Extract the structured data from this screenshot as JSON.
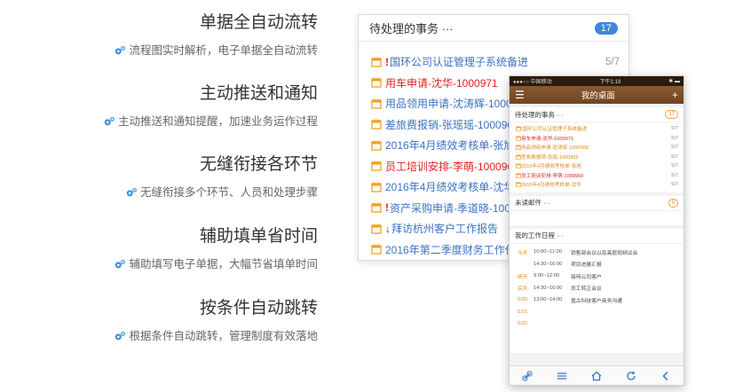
{
  "features": [
    {
      "title": "单据全自动流转",
      "desc": "流程图实时解析，电子单据全自动流转"
    },
    {
      "title": "主动推送和通知",
      "desc": "主动推送和通知提醒，加速业务运作过程"
    },
    {
      "title": "无缝衔接各环节",
      "desc": "无缝衔接多个环节、人员和处理步骤"
    },
    {
      "title": "辅助填单省时间",
      "desc": "辅助填写电子单据，大幅节省填单时间"
    },
    {
      "title": "按条件自动跳转",
      "desc": "根据条件自动跳转，管理制度有效落地"
    }
  ],
  "panel": {
    "title": "待处理的事务 ···",
    "count": "17",
    "items": [
      {
        "mark": "!",
        "text": "国环公司认证管理子系统备进",
        "count": "5/7",
        "color": "blue"
      },
      {
        "mark": "",
        "text": "用车申请-沈华-1000971",
        "count": "5/7",
        "color": "red"
      },
      {
        "mark": "",
        "text": "用品领用申请-沈涛辉-1000968",
        "count": "",
        "color": "blue"
      },
      {
        "mark": "",
        "text": "差旅费报销-张瑶瑶-1000965",
        "count": "",
        "color": "blue"
      },
      {
        "mark": "",
        "text": "2016年4月绩效考核单-张旭",
        "count": "",
        "color": "blue"
      },
      {
        "mark": "",
        "text": "员工培训安排-李萌-1000960",
        "count": "",
        "color": "red"
      },
      {
        "mark": "",
        "text": "2016年4月绩效考核单-沈华",
        "count": "",
        "color": "blue"
      },
      {
        "mark": "!",
        "text": "资产采购申请-季道晓-1000963",
        "count": "",
        "color": "blue"
      },
      {
        "mark": "↓",
        "text": "拜访杭州客户工作报告",
        "count": "",
        "color": "blue"
      },
      {
        "mark": "",
        "text": "2016年第二季度财务工作任务",
        "count": "",
        "color": "blue"
      }
    ]
  },
  "phone": {
    "status_left": "●●●○○ 中国移动 ",
    "status_time": "下午1:19",
    "status_right": "✱ ▬",
    "title": "我的桌面",
    "tasks": {
      "title": "待处理的事务 ···",
      "count": "17",
      "items": [
        {
          "text": "!国环公司认证管理子系统备进",
          "count": "5/7",
          "color": "orange"
        },
        {
          "text": "用车申请-沈华-1000971",
          "count": "5/7",
          "color": "red"
        },
        {
          "text": "用品领用申请-沈涛辉-1000968",
          "count": "5/7",
          "color": "orange"
        },
        {
          "text": "差旅费报销-张瑶-1000965",
          "count": "5/7",
          "color": "orange"
        },
        {
          "text": "2016年4月绩效考核单-张旭",
          "count": "5/7",
          "color": "orange"
        },
        {
          "text": "员工培训安排-李萌-1000960",
          "count": "5/7",
          "color": "red"
        },
        {
          "text": "2016年4月绩效考核单-沈华",
          "count": "5/7",
          "color": "orange"
        }
      ]
    },
    "mail": {
      "title": "未读邮件 ···",
      "count": "0"
    },
    "schedule": {
      "title": "我的工作日程 ···",
      "items": [
        {
          "day": "今天",
          "time": "10:00~11:00",
          "event": "销售部会议以及高层视频议会"
        },
        {
          "day": "",
          "time": "14:30~16:00",
          "event": "项目进展汇报"
        },
        {
          "day": "明天",
          "time": "9:00~12:00",
          "event": "接待公司客户"
        },
        {
          "day": "后天",
          "time": "14:30~16:00",
          "event": "员工转正会议"
        },
        {
          "day": "5/20",
          "time": "13:00~14:00",
          "event": "盘古科技客户商务沟通"
        },
        {
          "day": "5/21",
          "time": "",
          "event": ""
        },
        {
          "day": "5/22",
          "time": "",
          "event": ""
        }
      ]
    },
    "tabs": [
      "link-icon",
      "menu-icon",
      "home-icon",
      "refresh-icon",
      "back-icon"
    ]
  },
  "colors": {
    "accent_blue": "#3f86d8",
    "brown_bar": "#7a4c26",
    "orange": "#e08a1c",
    "red": "#e02020",
    "link_blue": "#3a72c4"
  }
}
